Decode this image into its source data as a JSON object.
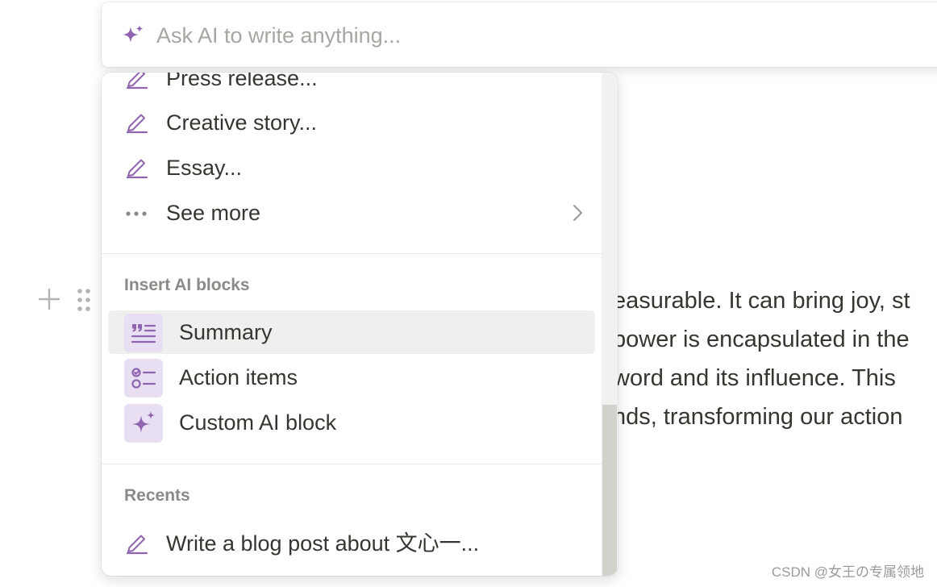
{
  "document": {
    "lines": [
      "easurable. It can bring joy, st",
      "power is encapsulated in the",
      " word and its influence. This",
      "nds, transforming our action"
    ]
  },
  "ai_input": {
    "placeholder": "Ask AI to write anything...",
    "value": "",
    "icon": "sparkle-icon"
  },
  "menu": {
    "write_items": [
      {
        "label": "Press release...",
        "icon": "pencil-icon"
      },
      {
        "label": "Creative story...",
        "icon": "pencil-icon"
      },
      {
        "label": "Essay...",
        "icon": "pencil-icon"
      }
    ],
    "see_more": {
      "label": "See more",
      "icon": "more-dots-icon"
    },
    "ai_blocks": {
      "section_label": "Insert AI blocks",
      "items": [
        {
          "label": "Summary",
          "icon": "summary-quote-icon"
        },
        {
          "label": "Action items",
          "icon": "checklist-icon"
        },
        {
          "label": "Custom AI block",
          "icon": "sparkle-icon"
        }
      ]
    },
    "recents": {
      "section_label": "Recents",
      "items": [
        {
          "label": "Write a blog post about 文心一...",
          "icon": "pencil-icon"
        }
      ]
    }
  },
  "colors": {
    "accent_purple": "#9065b0",
    "tile_bg": "#e8dff2",
    "hover_bg": "#efefee",
    "text": "#37352f",
    "muted": "#8b8a86"
  },
  "watermark": "CSDN @女王の专属领地"
}
